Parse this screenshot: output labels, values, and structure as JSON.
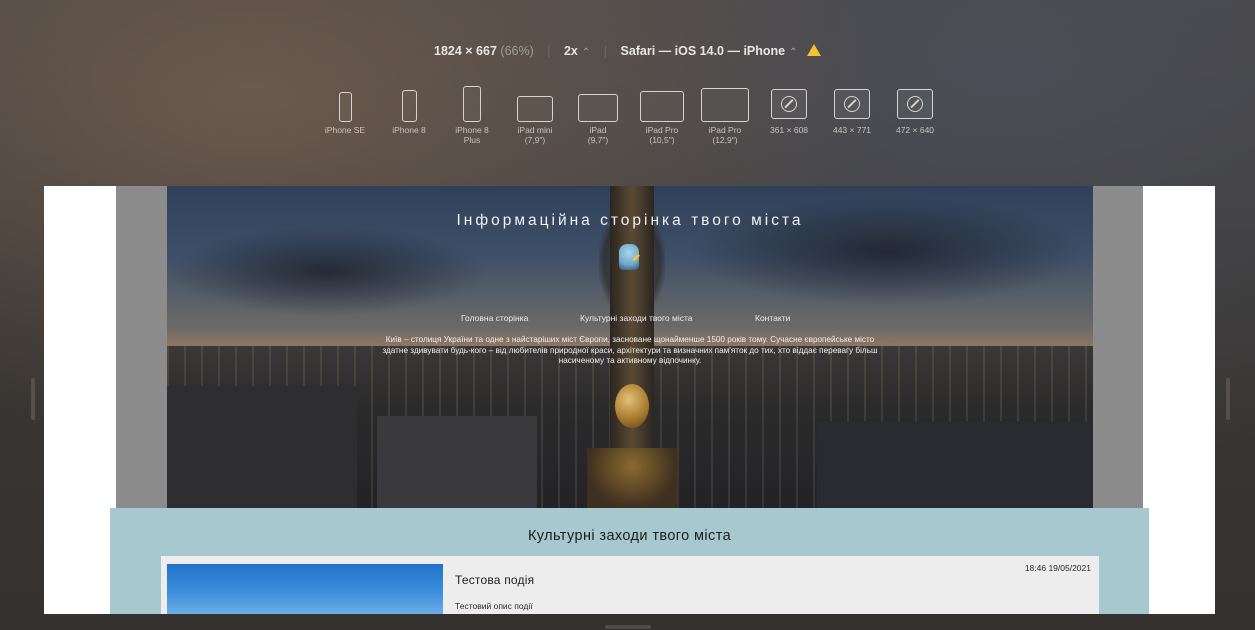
{
  "toolbar": {
    "resolution": "1824 × 667",
    "zoom": "(66%)",
    "scale": "2x",
    "scale_chevron": "⌃",
    "browser": "Safari — iOS 14.0 — iPhone",
    "browser_chevron": "⌃"
  },
  "devices": [
    {
      "label": "iPhone SE"
    },
    {
      "label": "iPhone 8"
    },
    {
      "label": "iPhone 8\nPlus"
    },
    {
      "label": "iPad mini\n(7,9\")"
    },
    {
      "label": "iPad\n(9,7\")"
    },
    {
      "label": "iPad Pro\n(10,5\")"
    },
    {
      "label": "iPad Pro\n(12,9\")"
    },
    {
      "label": "361 × 608"
    },
    {
      "label": "443 × 771"
    },
    {
      "label": "472 × 640"
    }
  ],
  "site": {
    "title": "Інформаційна сторінка твого міста",
    "nav": {
      "home": "Головна сторінка",
      "events": "Культурні заходи твого міста",
      "contacts": "Контакти"
    },
    "intro": "Київ – столиця України та одне з найстаріших міст Європи, засноване щонайменше 1500 років тому. Сучасне європейське місто здатне здивувати будь-кого – від любителів природної краси, архітектури та визначних пам'яток до тих, хто віддає перевагу більш насиченому та активному відпочинку.",
    "events_title": "Культурні заходи твого міста",
    "event": {
      "name": "Тестова подія",
      "description": "Тестовий опис події",
      "datetime": "18:46 19/05/2021"
    }
  },
  "colors": {
    "events_bg": "#a6c8cf",
    "card_bg": "#ededed",
    "warning": "#f2c230"
  }
}
